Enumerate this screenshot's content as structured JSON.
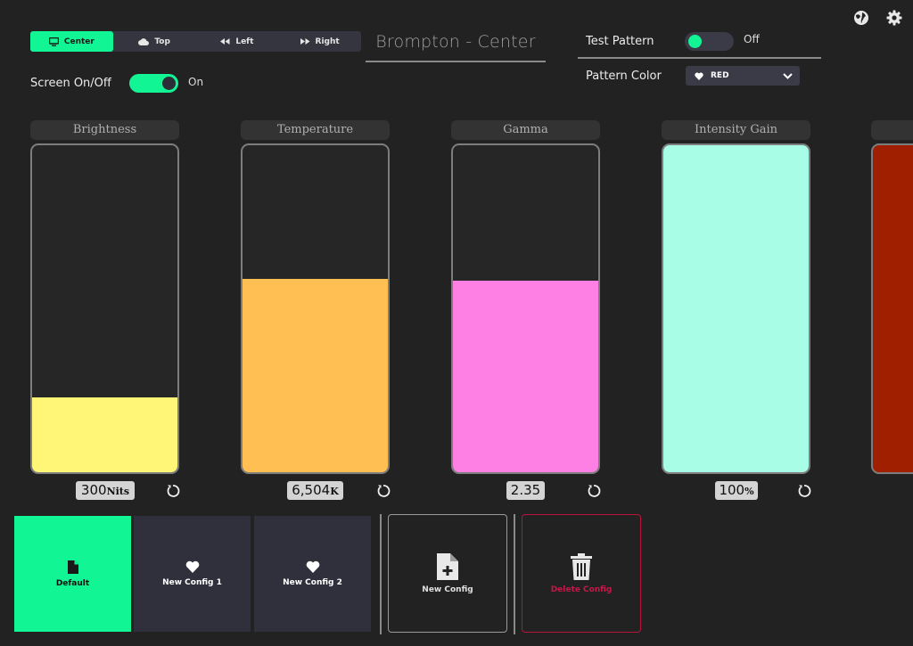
{
  "tabs": [
    {
      "label": "Center",
      "icon": "monitor-icon",
      "active": true
    },
    {
      "label": "Top",
      "icon": "cloud-icon",
      "active": false
    },
    {
      "label": "Left",
      "icon": "rewind-icon",
      "active": false
    },
    {
      "label": "Right",
      "icon": "fast-forward-icon",
      "active": false
    }
  ],
  "screen_title": "Brompton - Center",
  "screen_toggle": {
    "label": "Screen On/Off",
    "state": "On",
    "on": true
  },
  "test_pattern": {
    "label": "Test Pattern",
    "state": "Off",
    "on": false
  },
  "pattern_color": {
    "label": "Pattern Color",
    "value": "RED",
    "icon": "heart-icon"
  },
  "top_icons": [
    "globe-icon",
    "gear-icon"
  ],
  "sliders": [
    {
      "label": "Brightness",
      "value": "300",
      "unit": "Nits",
      "fill_fraction": 0.23,
      "color": "#fff577"
    },
    {
      "label": "Temperature",
      "value": "6,504",
      "unit": "K",
      "fill_fraction": 0.59,
      "color": "#ffbf52"
    },
    {
      "label": "Gamma",
      "value": "2.35",
      "unit": "",
      "fill_fraction": 0.585,
      "color": "#ff80e4"
    },
    {
      "label": "Intensity Gain",
      "value": "100",
      "unit": "%",
      "fill_fraction": 1.0,
      "color": "#a8fde6"
    }
  ],
  "partial_slider_color": "#a01f00",
  "presets": [
    {
      "label": "Default",
      "icon": "file-icon",
      "active": true
    },
    {
      "label": "New Config 1",
      "icon": "heart-icon",
      "active": false
    },
    {
      "label": "New Config 2",
      "icon": "heart-icon",
      "active": false
    }
  ],
  "actions": {
    "new_config": {
      "label": "New Config",
      "icon": "file-plus-icon"
    },
    "delete_config": {
      "label": "Delete Config",
      "icon": "trash-icon"
    }
  },
  "colors": {
    "accent": "#12f595",
    "background": "#222222",
    "danger": "#c8164a"
  }
}
